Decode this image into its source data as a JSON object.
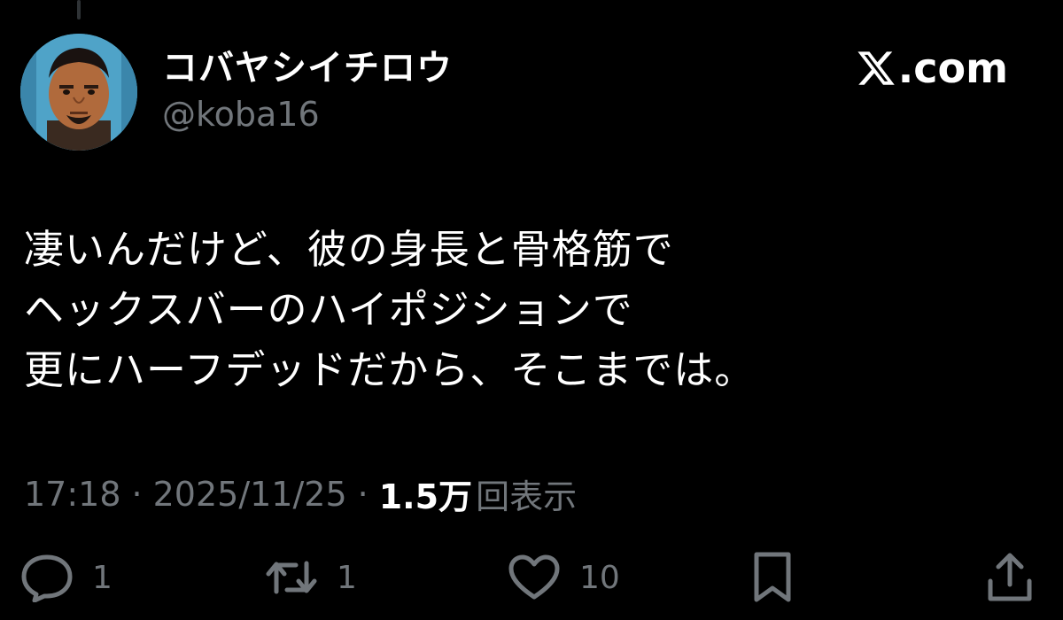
{
  "tweet": {
    "author": {
      "display_name": "コバヤシイチロウ",
      "handle": "@koba16"
    },
    "brand": ".com",
    "text_lines": [
      "凄いんだけど、彼の身長と骨格筋で",
      "ヘックスバーのハイポジションで",
      "更にハーフデッドだから、そこまでは。"
    ],
    "meta": {
      "time": "17:18",
      "separator": "·",
      "date": "2025/11/25",
      "views_count": "1.5万",
      "views_label": "回表示"
    },
    "actions": {
      "replies": "1",
      "reposts": "1",
      "likes": "10"
    },
    "icons": {
      "reply": "reply-icon",
      "repost": "repost-icon",
      "like": "heart-icon",
      "bookmark": "bookmark-icon",
      "share": "share-icon",
      "brand": "x-logo-icon"
    },
    "colors": {
      "background": "#000000",
      "text": "#ffffff",
      "secondary": "#71767b"
    }
  }
}
